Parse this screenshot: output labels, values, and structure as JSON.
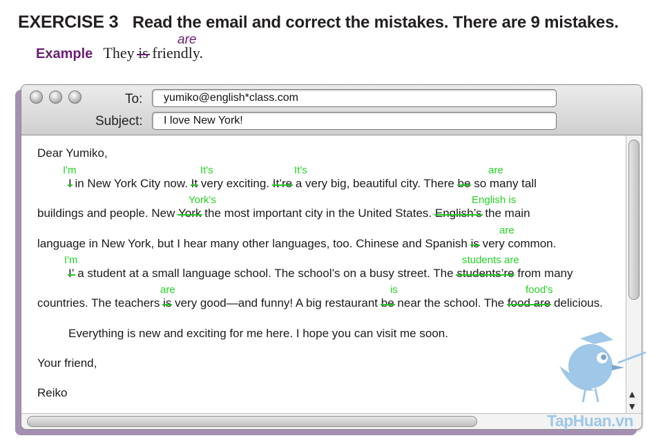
{
  "header": {
    "exercise": "EXERCISE 3",
    "instruction": "Read the email and correct the mistakes. There are 9 mistakes."
  },
  "example": {
    "label": "Example",
    "before": "They",
    "struck": "is",
    "after": "friendly.",
    "correction": "are"
  },
  "email": {
    "to_label": "To:",
    "to_value": "yumiko@english*class.com",
    "subject_label": "Subject:",
    "subject_value": "I love New York!",
    "greeting": "Dear Yumiko,",
    "p1": {
      "s1_strike": "I",
      "s1_rest": "in New York City now.",
      "s2_strike": "It",
      "s2_rest": "very exciting.",
      "s3_strike": "It’re",
      "s3_rest": "a very big, beautiful city. There",
      "s4_strike": "be",
      "s4_rest": "so many tall",
      "l2_a": "buildings and people. New",
      "l2_strike1": "York",
      "l2_b": "the most important city in the United States.",
      "l2_strike2": "English’s",
      "l2_c": "the main",
      "l3_a": "language in New York, but I hear many other languages, too. Chinese and Spanish",
      "l3_strike": "is",
      "l3_b": "very common.",
      "l4_strike1": "I’",
      "l4_a": "a student at a small language school. The school’s on a busy street. The",
      "l4_strike2": "students’re",
      "l4_b": "from many",
      "l5_a": "countries. The teachers",
      "l5_strike1": "is",
      "l5_b": "very good—and funny! A big restaurant",
      "l5_strike2": "be",
      "l5_c": "near the school. The",
      "l5_strike3": "food are",
      "l5_d": "delicious."
    },
    "p2": "Everything is new and exciting for me here. I hope you can visit me soon.",
    "closing": "Your friend,",
    "signature": "Reiko"
  },
  "corrections": {
    "c1": "I'm",
    "c2": "It's",
    "c3": "It's",
    "c4": "are",
    "c5": "York's",
    "c6": "English is",
    "c7": "are",
    "c8": "I'm",
    "c9": "students are",
    "c10": "are",
    "c11": "is",
    "c12": "food's"
  },
  "watermark": "TapHuan.vn",
  "colors": {
    "correction": "#22d322",
    "example_label": "#6a1e73",
    "window_shadow": "#a590b3"
  }
}
